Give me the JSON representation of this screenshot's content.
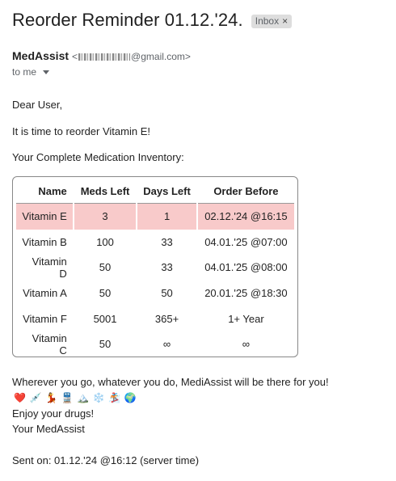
{
  "email": {
    "subject": "Reorder Reminder 01.12.'24.",
    "label": "Inbox",
    "label_close": "×",
    "sender_name": "MedAssist",
    "sender_email_prefix": "<",
    "sender_email_suffix": "@gmail.com>",
    "recipient": "to me"
  },
  "body": {
    "greeting": "Dear User,",
    "reminder": "It is time to reorder Vitamin E!",
    "inventory_heading": "Your Complete Medication Inventory:",
    "closing": "Wherever you go, whatever you do, MediAssist will be there for you!",
    "enjoy": "Enjoy your drugs!",
    "signature": "Your MedAssist",
    "sent_on": "Sent on: 01.12.'24 @16:12 (server time)"
  },
  "table": {
    "headers": [
      "Name",
      "Meds Left",
      "Days Left",
      "Order Before"
    ],
    "rows": [
      [
        "Vitamin E",
        "3",
        "1",
        "02.12.'24 @16:15"
      ],
      [
        "Vitamin B",
        "100",
        "33",
        "04.01.'25 @07:00"
      ],
      [
        "Vitamin D",
        "50",
        "33",
        "04.01.'25 @08:00"
      ],
      [
        "Vitamin A",
        "50",
        "50",
        "20.01.'25 @18:30"
      ],
      [
        "Vitamin F",
        "5001",
        "365+",
        "1+ Year"
      ],
      [
        "Vitamin C",
        "50",
        "∞",
        "∞"
      ]
    ],
    "highlight_color": "#f8caca"
  },
  "emojis": [
    {
      "name": "heart-icon",
      "glyph": "❤️"
    },
    {
      "name": "syringe-icon",
      "glyph": "💉"
    },
    {
      "name": "dancer-icon",
      "glyph": "💃"
    },
    {
      "name": "train-icon",
      "glyph": "🚆"
    },
    {
      "name": "mountain-icon",
      "glyph": "🏔️"
    },
    {
      "name": "snowflake-icon",
      "glyph": "❄️"
    },
    {
      "name": "snowboarder-icon",
      "glyph": "🏂"
    },
    {
      "name": "globe-icon",
      "glyph": "🌍"
    }
  ]
}
